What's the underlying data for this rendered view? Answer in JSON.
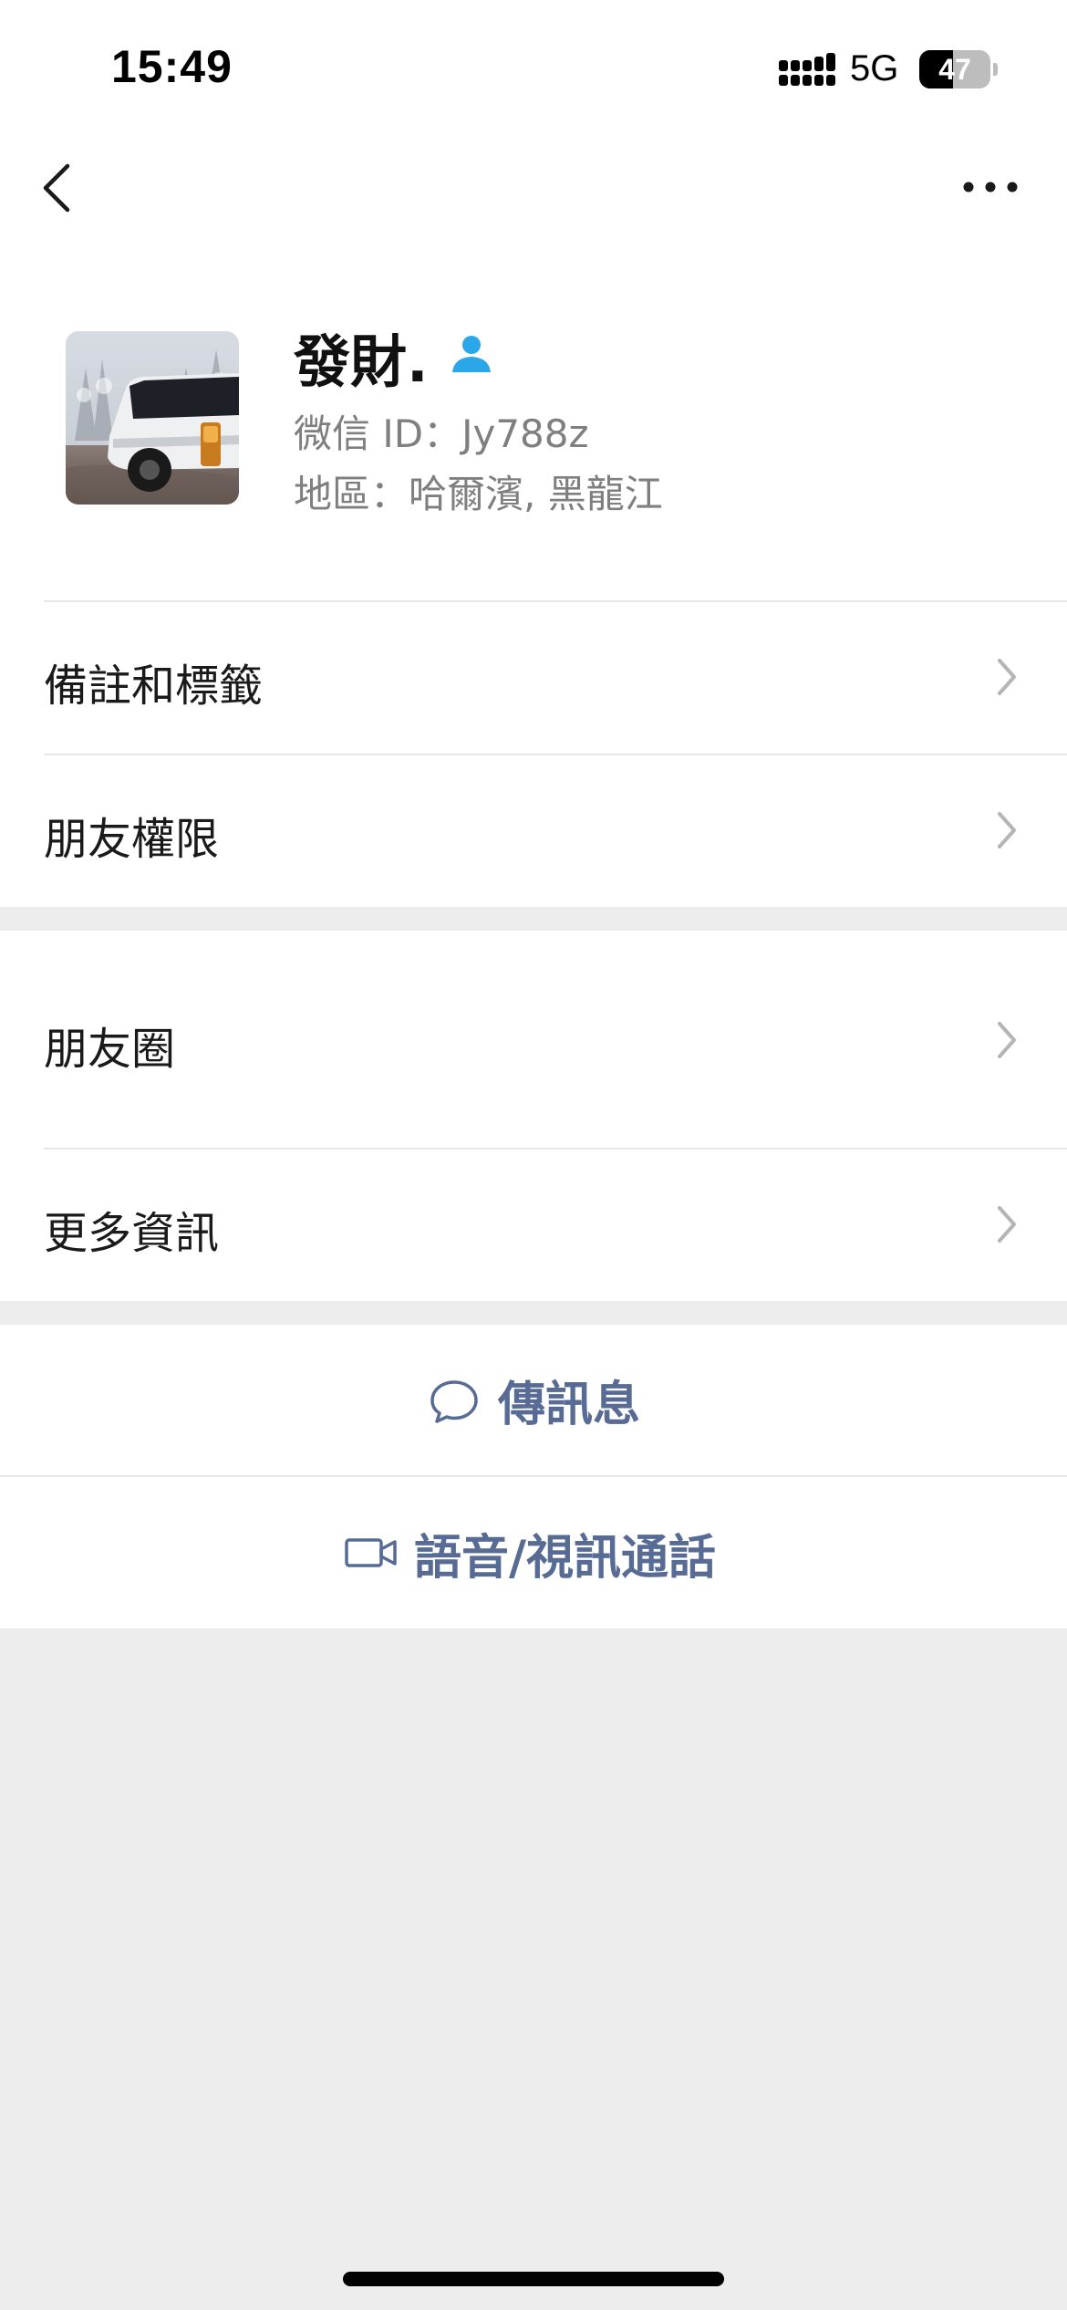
{
  "status_bar": {
    "time": "15:49",
    "network": "5G",
    "battery_level": "47",
    "battery_fraction": 0.47
  },
  "nav": {
    "back_icon": "chevron-left-icon",
    "more_icon": "more-horizontal-icon"
  },
  "profile": {
    "name": "發財.",
    "name_icon": "person-icon",
    "id_row": "微信 ID：Jy788z",
    "region_row": "地區：哈爾濱, 黑龍江"
  },
  "menu": {
    "remarks_tags": "備註和標籤",
    "friend_permissions": "朋友權限",
    "moments": "朋友圈",
    "more_info": "更多資訊"
  },
  "actions": {
    "message": "傳訊息",
    "message_icon": "chat-bubble-icon",
    "call": "語音/視訊通話",
    "call_icon": "video-camera-icon"
  },
  "colors": {
    "accent": "#576b95",
    "person_icon": "#2aa7e8",
    "background": "#ededed"
  }
}
